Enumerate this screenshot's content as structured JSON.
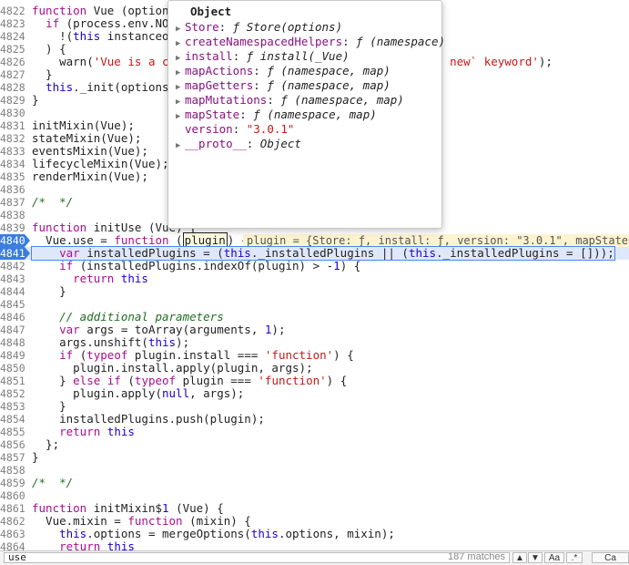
{
  "code_lines": [
    {
      "n": "4822",
      "t": "function Vue (options"
    },
    {
      "n": "4823",
      "t": "  if (process.env.NOD"
    },
    {
      "n": "4824",
      "t": "    !(this instanceof"
    },
    {
      "n": "4825",
      "t": "  ) {"
    },
    {
      "n": "4826",
      "t": "    warn('Vue is a co                                        new` keyword');"
    },
    {
      "n": "4827",
      "t": "  }"
    },
    {
      "n": "4828",
      "t": "  this._init(options)"
    },
    {
      "n": "4829",
      "t": "}"
    },
    {
      "n": "4830",
      "t": ""
    },
    {
      "n": "4831",
      "t": "initMixin(Vue);"
    },
    {
      "n": "4832",
      "t": "stateMixin(Vue);"
    },
    {
      "n": "4833",
      "t": "eventsMixin(Vue);"
    },
    {
      "n": "4834",
      "t": "lifecycleMixin(Vue);"
    },
    {
      "n": "4835",
      "t": "renderMixin(Vue);"
    },
    {
      "n": "4836",
      "t": ""
    },
    {
      "n": "4837",
      "t": "/*  */"
    },
    {
      "n": "4838",
      "t": ""
    },
    {
      "n": "4839",
      "t": "function initUse (Vue) {"
    },
    {
      "n": "4840",
      "t": "  Vue.use = function (plugin) {"
    },
    {
      "n": "4841",
      "t": "    var installedPlugins = (this._installedPlugins || (this._installedPlugins = []));"
    },
    {
      "n": "4842",
      "t": "    if (installedPlugins.indexOf(plugin) > -1) {"
    },
    {
      "n": "4843",
      "t": "      return this"
    },
    {
      "n": "4844",
      "t": "    }"
    },
    {
      "n": "4845",
      "t": ""
    },
    {
      "n": "4846",
      "t": "    // additional parameters"
    },
    {
      "n": "4847",
      "t": "    var args = toArray(arguments, 1);"
    },
    {
      "n": "4848",
      "t": "    args.unshift(this);"
    },
    {
      "n": "4849",
      "t": "    if (typeof plugin.install === 'function') {"
    },
    {
      "n": "4850",
      "t": "      plugin.install.apply(plugin, args);"
    },
    {
      "n": "4851",
      "t": "    } else if (typeof plugin === 'function') {"
    },
    {
      "n": "4852",
      "t": "      plugin.apply(null, args);"
    },
    {
      "n": "4853",
      "t": "    }"
    },
    {
      "n": "4854",
      "t": "    installedPlugins.push(plugin);"
    },
    {
      "n": "4855",
      "t": "    return this"
    },
    {
      "n": "4856",
      "t": "  };"
    },
    {
      "n": "4857",
      "t": "}"
    },
    {
      "n": "4858",
      "t": ""
    },
    {
      "n": "4859",
      "t": "/*  */"
    },
    {
      "n": "4860",
      "t": ""
    },
    {
      "n": "4861",
      "t": "function initMixin$1 (Vue) {"
    },
    {
      "n": "4862",
      "t": "  Vue.mixin = function (mixin) {"
    },
    {
      "n": "4863",
      "t": "    this.options = mergeOptions(this.options, mixin);"
    },
    {
      "n": "4864",
      "t": "    return this"
    }
  ],
  "breakpoint_lines": [
    "4840",
    "4841"
  ],
  "paused_line": "4841",
  "inline_preview": {
    "text": "plugin = {Store: ƒ, install: ƒ, version: \"3.0.1\", mapState"
  },
  "popover": {
    "title": "Object",
    "rows": [
      {
        "key": "Store",
        "sep": ": ",
        "val": "ƒ Store(options)",
        "expandable": true
      },
      {
        "key": "createNamespacedHelpers",
        "sep": ": ",
        "val": "ƒ (namespace)",
        "expandable": true
      },
      {
        "key": "install",
        "sep": ": ",
        "val": "ƒ install(_Vue)",
        "expandable": true
      },
      {
        "key": "mapActions",
        "sep": ": ",
        "val": "ƒ (namespace, map)",
        "expandable": true
      },
      {
        "key": "mapGetters",
        "sep": ": ",
        "val": "ƒ (namespace, map)",
        "expandable": true
      },
      {
        "key": "mapMutations",
        "sep": ": ",
        "val": "ƒ (namespace, map)",
        "expandable": true
      },
      {
        "key": "mapState",
        "sep": ": ",
        "val": "ƒ (namespace, map)",
        "expandable": true
      },
      {
        "key": "version",
        "sep": ": ",
        "val": "\"3.0.1\"",
        "expandable": false
      },
      {
        "key": "__proto__",
        "sep": ": ",
        "val": "Object",
        "expandable": true
      }
    ]
  },
  "search": {
    "value": "use",
    "match_count": "187 matches",
    "prev_label": "▲",
    "next_label": "▼",
    "case_label": "Aa",
    "regex_label": ".*",
    "cancel_label": "Ca"
  },
  "colors": {
    "breakpoint": "#3b7de0",
    "paused_bg": "#dfe8fb",
    "keyword": "#aa0d91",
    "string": "#c41a16",
    "comment": "#236e25"
  }
}
